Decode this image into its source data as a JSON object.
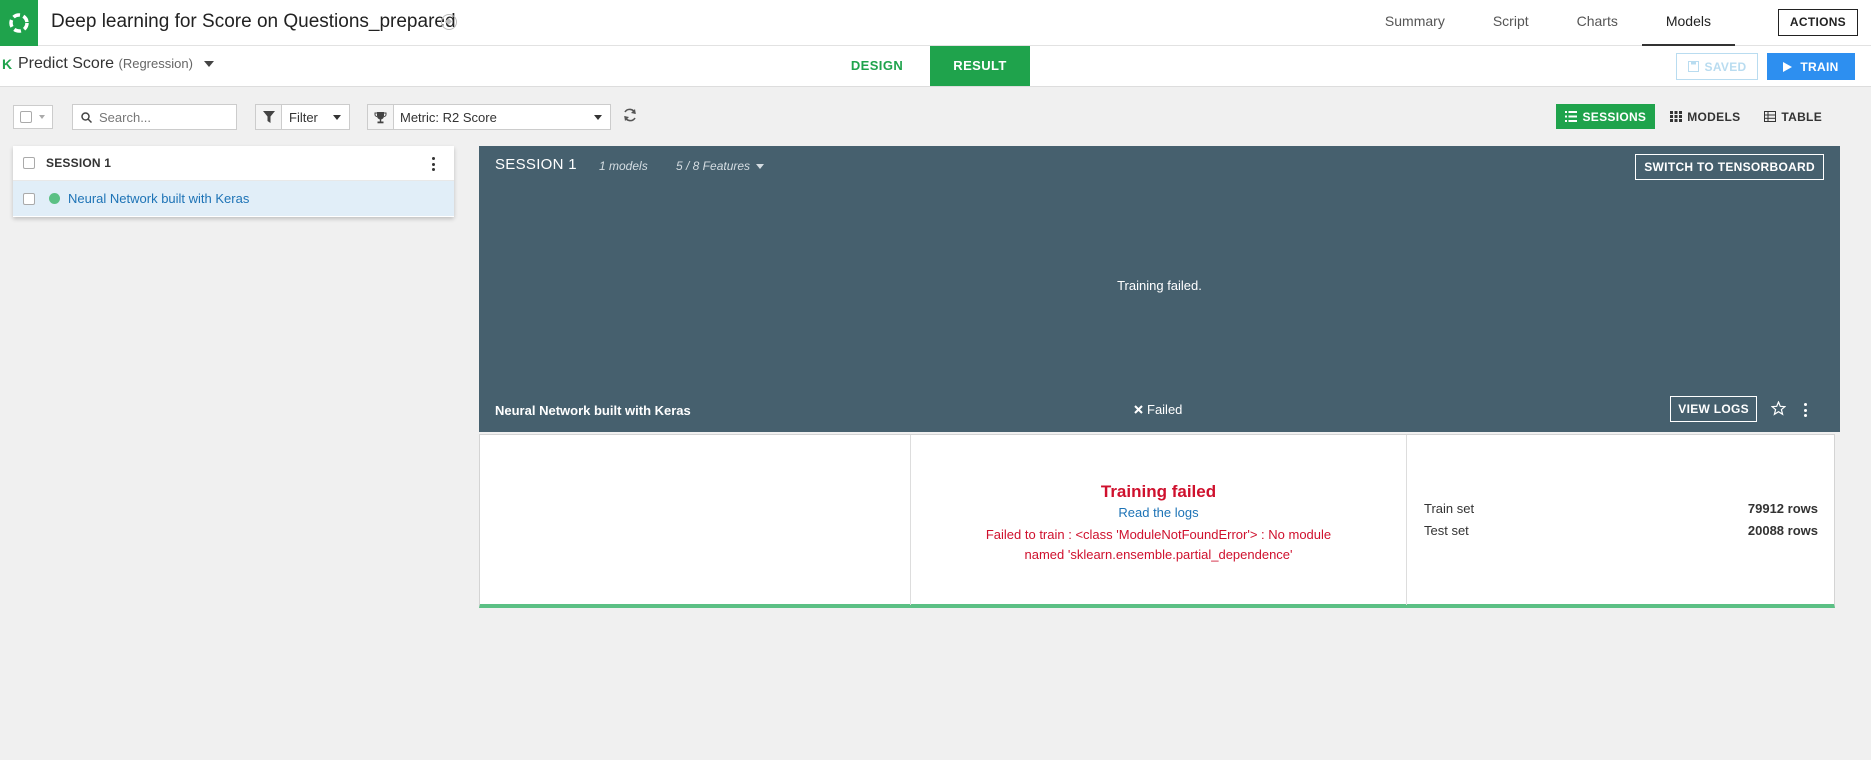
{
  "header": {
    "title": "Deep learning for Score on Questions_prepared",
    "nav": [
      "Summary",
      "Script",
      "Charts",
      "Models"
    ],
    "active_nav": "Models",
    "actions_label": "ACTIONS"
  },
  "subheader": {
    "badge": "K",
    "task": "Predict Score",
    "task_type": "(Regression)",
    "tabs": {
      "design": "DESIGN",
      "result": "RESULT"
    },
    "saved_label": "SAVED",
    "train_label": "TRAIN"
  },
  "toolbar": {
    "search_placeholder": "Search...",
    "filter_label": "Filter",
    "metric_label": "Metric: R2 Score",
    "views": {
      "sessions": "SESSIONS",
      "models": "MODELS",
      "table": "TABLE"
    }
  },
  "session_list": {
    "title": "SESSION 1",
    "models": [
      "Neural Network built with Keras"
    ]
  },
  "panel": {
    "title": "SESSION 1",
    "models_count": "1 models",
    "features": "5 / 8 Features",
    "tensorboard_label": "SWITCH TO TENSORBOARD",
    "training_failed_msg": "Training failed.",
    "model_name": "Neural Network built with Keras",
    "status": "Failed",
    "view_logs_label": "VIEW LOGS"
  },
  "detail": {
    "error_title": "Training failed",
    "logs_link": "Read the logs",
    "error_message": "Failed to train : <class 'ModuleNotFoundError'> : No module named 'sklearn.ensemble.partial_dependence'",
    "train_set_label": "Train set",
    "train_set_value": "79912 rows",
    "test_set_label": "Test set",
    "test_set_value": "20088 rows"
  },
  "colors": {
    "brand_green": "#1fa34c",
    "panel_slate": "#46606e",
    "error_red": "#cf102d",
    "link_blue": "#1d73b6",
    "train_blue": "#2d8ff0"
  }
}
